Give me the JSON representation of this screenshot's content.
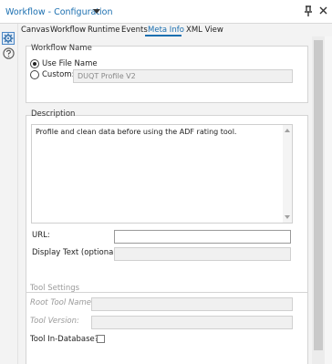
{
  "window": {
    "title": "Workflow - Configuration"
  },
  "icons": {
    "dropdown": "chevron-down-icon",
    "pin": "pin-icon",
    "close": "close-icon",
    "config": "gear-icon",
    "help": "help-icon"
  },
  "tabs": [
    {
      "label": "Canvas"
    },
    {
      "label": "Workflow"
    },
    {
      "label": "Runtime"
    },
    {
      "label": "Events"
    },
    {
      "label": "Meta Info",
      "active": true
    },
    {
      "label": "XML View"
    }
  ],
  "workflow_name": {
    "section_label": "Workflow Name",
    "options": [
      {
        "label": "Use File Name",
        "checked": true
      },
      {
        "label": "Custom:",
        "checked": false
      }
    ],
    "custom_value": "DUQT Profile V2"
  },
  "description": {
    "section_label": "Description",
    "text": "Profile and clean data before using the ADF rating tool.",
    "url_label": "URL:",
    "url_value": "",
    "display_text_label": "Display Text (optional):",
    "display_text_value": ""
  },
  "tool_settings": {
    "section_label": "Tool Settings",
    "root_tool_name_label": "Root Tool Name:",
    "root_tool_name_value": "",
    "tool_version_label": "Tool Version:",
    "tool_version_value": "",
    "in_database_label": "Tool In-Database?",
    "in_database_checked": false
  },
  "colors": {
    "accent": "#1b6fb0",
    "panel": "#ffffff",
    "background": "#f3f3f3"
  }
}
